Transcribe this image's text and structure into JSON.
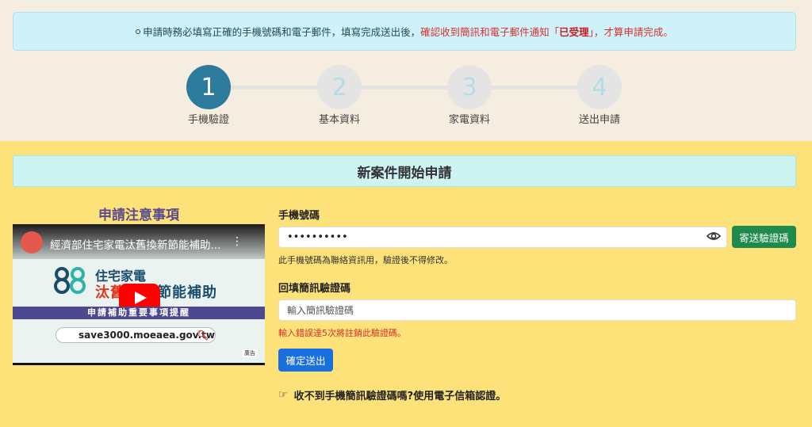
{
  "notice": {
    "part1": "申請時務必填寫正確的手機號碼和電子郵件，填寫完成送出後，",
    "part2": "確認收到簡訊和電子郵件通知「",
    "part3": "已受理",
    "part4": "」，才算申請完成。"
  },
  "steps": [
    {
      "num": "1",
      "label": "手機驗證",
      "active": true
    },
    {
      "num": "2",
      "label": "基本資料",
      "active": false
    },
    {
      "num": "3",
      "label": "家電資料",
      "active": false
    },
    {
      "num": "4",
      "label": "送出申請",
      "active": false
    }
  ],
  "banner_title": "新案件開始申請",
  "video": {
    "section_title": "申請注意事項",
    "title": "經濟部住宅家電汰舊換新節能補助...",
    "logo_line1": "住宅家電",
    "logo_line2a": "汰舊",
    "logo_line2b": "節能補助",
    "strip_text": "申請補助重要事項提醒",
    "url": "save3000.moeaea.gov.tw",
    "ad_label": "廣告"
  },
  "form": {
    "phone_label": "手機號碼",
    "phone_value": "••••••••••",
    "send_code_button": "寄送驗證碼",
    "phone_help": "此手機號碼為聯絡資訊用，驗證後不得修改。",
    "code_label": "回填簡訊驗證碼",
    "code_placeholder": "輸入簡訊驗證碼",
    "code_warning": "輸入錯誤達5次將註銷此驗證碼。",
    "submit_button": "確定送出",
    "email_link": "收不到手機簡訊驗證碼嗎?使用電子信箱認證。"
  },
  "colors": {
    "accent": "#2c7a9c",
    "main_bg": "#fde27a",
    "send_button": "#1e8a4c",
    "submit_button": "#1a6fe0",
    "warning": "#d62f2f"
  },
  "icons": {
    "eye": "eye-icon",
    "hand": "hand-point-icon",
    "play": "youtube-play-icon",
    "search": "search-icon"
  }
}
